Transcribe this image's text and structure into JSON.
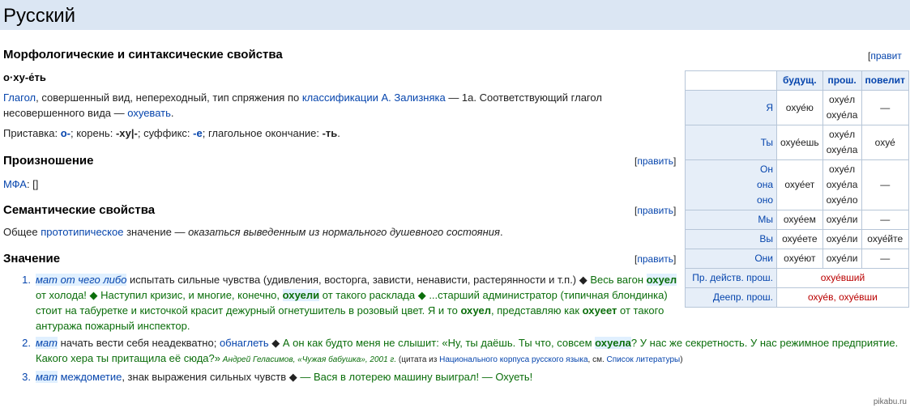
{
  "header": {
    "title": "Русский"
  },
  "morph": {
    "heading": "Морфологические и синтаксические свойства",
    "edit": "править",
    "word": "о·ху-е́ть",
    "pos_link": "Глагол",
    "pos_text": ", совершенный вид, непереходный, тип спряжения по ",
    "class_link": "классификации А. Зализняка",
    "class_text": " — 1a. Соответствующий глагол",
    "line2_text": "несовершенного вида — ",
    "impf_link": "охуевать",
    "dot": ".",
    "prefix_label": "Приставка: ",
    "prefix": "о-",
    "root_label": "; корень: ",
    "root": "-ху|-",
    "suffix_label": "; суффикс: ",
    "suffix": "-е",
    "ending_label": "; глагольное окончание: ",
    "ending": "-ть",
    "end": "."
  },
  "pron": {
    "heading": "Произношение",
    "edit": "править",
    "ipa_link": "МФА",
    "ipa_text": ": []"
  },
  "sem": {
    "heading": "Семантические свойства",
    "edit": "править",
    "text1": "Общее ",
    "link": "прототипическое",
    "text2": " значение — ",
    "meaning": "оказаться выведенным из нормального душевного состояния",
    "end": "."
  },
  "meaning": {
    "heading": "Значение",
    "edit": "править",
    "items": [
      {
        "num": "1.",
        "mat": "мат от чего либо",
        "l1": " испытать сильные чувства (удивления, восторга, зависти, ненависти, растерянности и т.п.) ◆ ",
        "l1g": "Весь вагон ",
        "l1b": "охуел",
        "l2": "от холода! ◆ Наступил кризис, и многие, конечно, ",
        "l2b": "охуели",
        "l2c": " от такого расклада ◆ ...старший администратор (типичная блондинка)",
        "l3": "стоит на табуретке и кисточкой красит дежурный огнетушитель в розовый цвет. Я и то ",
        "l3b": "охуел",
        "l3c": ", представляю как ",
        "l3d": "охуеет",
        "l3e": " от такого",
        "l4": "антуража пожарный инспектор."
      },
      {
        "num": "2.",
        "mat": "мат",
        "l1": " начать вести себя неадекватно; ",
        "link": "обнаглеть",
        "l1b": " ◆ ",
        "l1g": "А он как будто меня не слышит: «Ну, ты даёшь. Ты что, совсем ",
        "l1h": "охуела",
        "l1i": "? У нас же секретность. У нас режимное предприятие.",
        "l2": "Какого хера ты притащила её сюда?»",
        "cite": " Андрей Геласимов, «Чужая бабушка», 2001 г.",
        "cite2": " (цитата из ",
        "cite_link": "Национального корпуса русского языка",
        "cite3": ", см. ",
        "cite_link2": "Список литературы",
        "cite4": ")"
      },
      {
        "num": "3.",
        "mat": "мат",
        "sp": " ",
        "link": "междометие",
        "l1": ", знак выражения сильных чувств ◆ ",
        "l1g": " — Вася в лотерею машину выиграл! — Охуеть!"
      }
    ]
  },
  "table": {
    "edit": "правит",
    "headers": [
      "будущ.",
      "прош.",
      "повелит"
    ],
    "rows": [
      {
        "pr": "Я",
        "fut": "охуе́ю",
        "past": "охуе́л\nохуе́ла",
        "imp": "—"
      },
      {
        "pr": "Ты",
        "fut": "охуе́ешь",
        "past": "охуе́л\nохуе́ла",
        "imp": "охуе́"
      },
      {
        "pr": "Он\nона\nоно",
        "fut": "охуе́ет",
        "past": "охуе́л\nохуе́ла\nохуе́ло",
        "imp": "—"
      },
      {
        "pr": "Мы",
        "fut": "охуе́ем",
        "past": "охуе́ли",
        "imp": "—"
      },
      {
        "pr": "Вы",
        "fut": "охуе́ете",
        "past": "охуе́ли",
        "imp": "охуе́йте"
      },
      {
        "pr": "Они",
        "fut": "охуе́ют",
        "past": "охуе́ли",
        "imp": "—"
      }
    ],
    "participle_label": "Пр. действ. прош.",
    "participle": "охуе́вший",
    "gerund_label": "Деепр. прош.",
    "gerund": "охуе́в, охуе́вши"
  },
  "footer": {
    "logo": "pikabu.ru"
  }
}
